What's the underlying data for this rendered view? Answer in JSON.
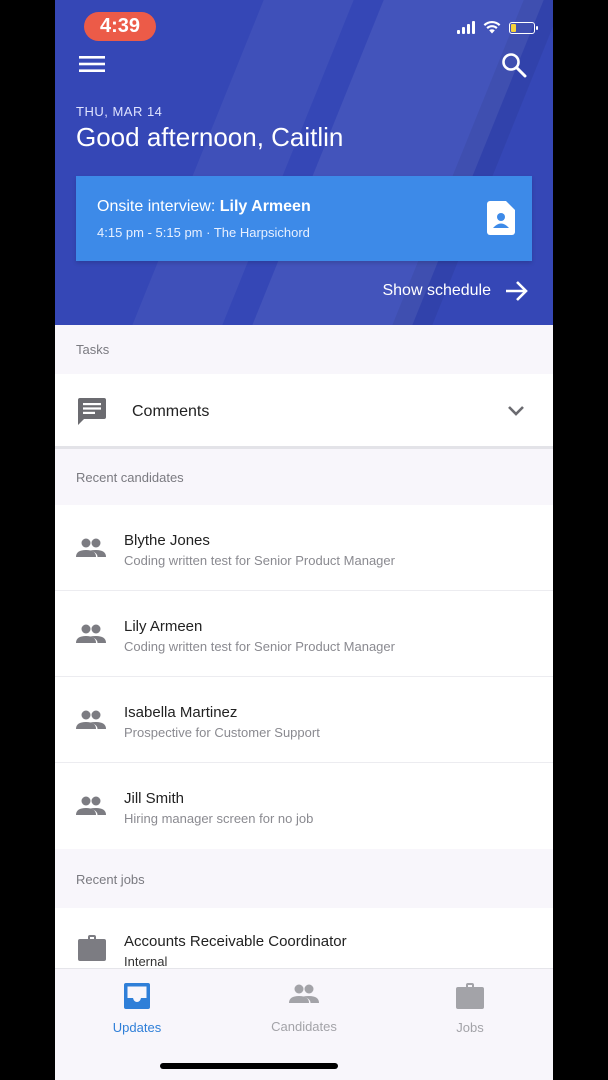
{
  "status_bar": {
    "time": "4:39"
  },
  "header": {
    "date": "THU, MAR 14",
    "greeting": "Good afternoon,  Caitlin",
    "event": {
      "title_prefix": "Onsite interview: ",
      "title_name": "Lily Armeen",
      "subtitle": "4:15 pm - 5:15 pm · The Harpsichord"
    },
    "show_schedule_label": "Show schedule"
  },
  "tasks": {
    "section_label": "Tasks",
    "comments_label": "Comments"
  },
  "recent_candidates": {
    "section_label": "Recent candidates",
    "items": [
      {
        "name": "Blythe Jones",
        "detail": "Coding written test for Senior Product Manager"
      },
      {
        "name": "Lily Armeen",
        "detail": "Coding written test for Senior Product Manager"
      },
      {
        "name": "Isabella Martinez",
        "detail": "Prospective for Customer Support"
      },
      {
        "name": "Jill Smith",
        "detail": "Hiring manager screen for no job"
      }
    ]
  },
  "recent_jobs": {
    "section_label": "Recent jobs",
    "items": [
      {
        "title": "Accounts Receivable Coordinator",
        "detail": "Internal"
      }
    ]
  },
  "bottom_nav": {
    "items": [
      {
        "label": "Updates",
        "icon": "inbox-icon",
        "active": true
      },
      {
        "label": "Candidates",
        "icon": "people-icon",
        "active": false
      },
      {
        "label": "Jobs",
        "icon": "briefcase-icon",
        "active": false
      }
    ]
  },
  "colors": {
    "header_bg": "#3547b6",
    "card_bg": "#3d8ae8",
    "accent": "#2f7fd8",
    "time_pill": "#ec5b48",
    "inactive_nav": "#a3a3a8"
  }
}
